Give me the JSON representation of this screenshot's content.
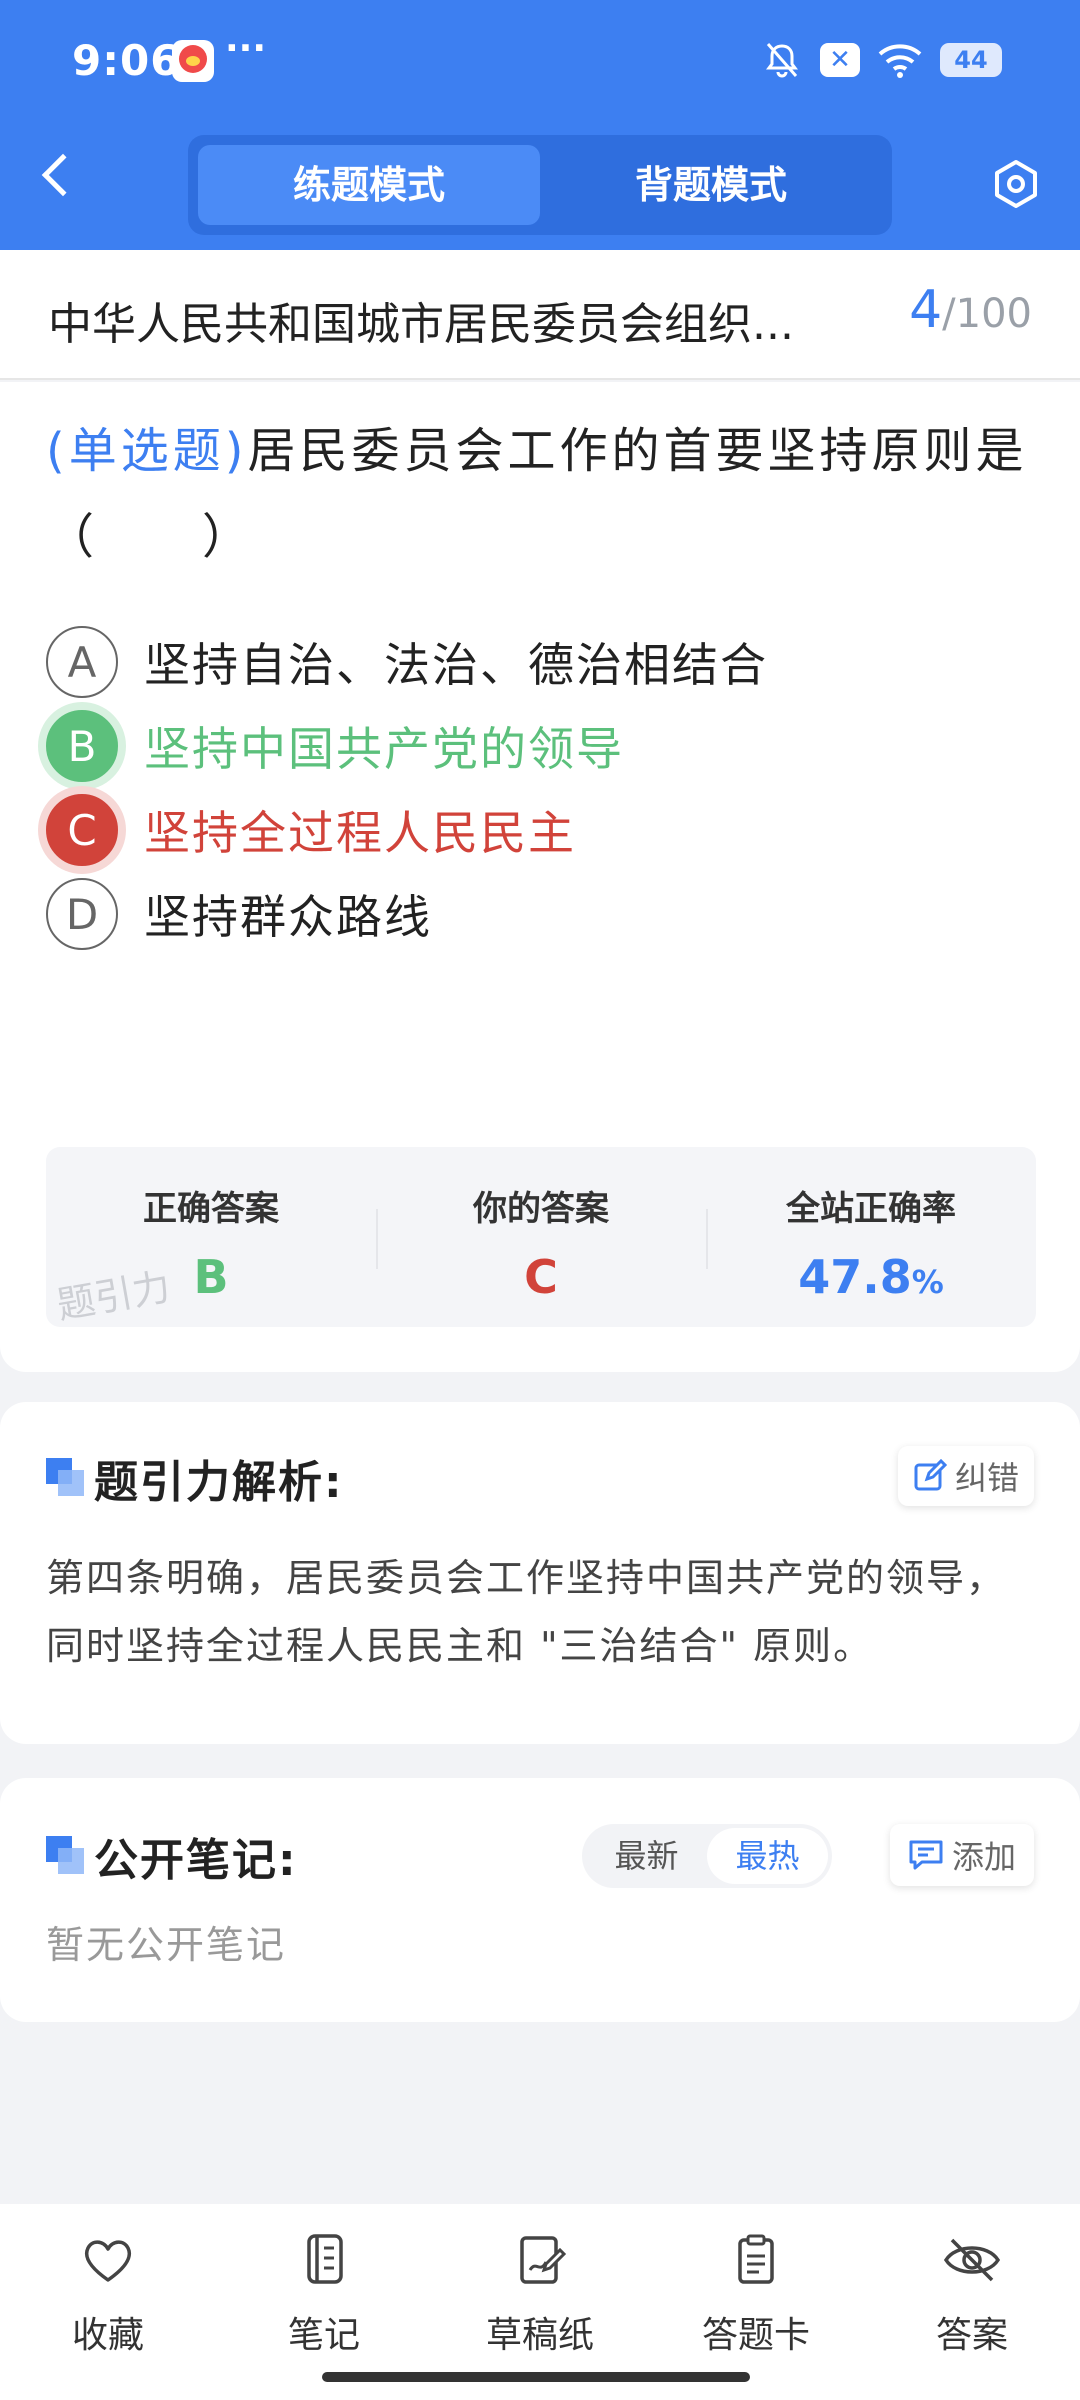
{
  "status_bar": {
    "time": "9:06",
    "more": "···",
    "battery": "44"
  },
  "header": {
    "modes": [
      "练题模式",
      "背题模式"
    ],
    "active_mode": "练题模式"
  },
  "title_bar": {
    "title": "中华人民共和国城市居民委员会组织...",
    "current": "4",
    "total": "/100"
  },
  "question": {
    "type": "(单选题)",
    "text": "居民委员会工作的首要坚持原则是（　　）",
    "options": [
      {
        "letter": "A",
        "text": "坚持自治、法治、德治相结合",
        "state": "normal"
      },
      {
        "letter": "B",
        "text": "坚持中国共产党的领导",
        "state": "correct"
      },
      {
        "letter": "C",
        "text": "坚持全过程人民民主",
        "state": "wrong"
      },
      {
        "letter": "D",
        "text": "坚持群众路线",
        "state": "normal"
      }
    ]
  },
  "stats": {
    "correct_label": "正确答案",
    "correct_value": "B",
    "yours_label": "你的答案",
    "yours_value": "C",
    "rate_label": "全站正确率",
    "rate_value": "47.8",
    "rate_unit": "%",
    "watermark": "题引力"
  },
  "analysis": {
    "title": "题引力解析:",
    "fix_label": "纠错",
    "text": "第四条明确，居民委员会工作坚持中国共产党的领导，同时坚持全过程人民民主和 \"三治结合\" 原则。"
  },
  "notes": {
    "title": "公开笔记:",
    "sort_options": [
      "最新",
      "最热"
    ],
    "active_sort": "最热",
    "add_label": "添加",
    "empty_text": "暂无公开笔记"
  },
  "bottom_nav": [
    {
      "label": "收藏",
      "icon": "heart-icon"
    },
    {
      "label": "笔记",
      "icon": "notebook-icon"
    },
    {
      "label": "草稿纸",
      "icon": "draft-icon"
    },
    {
      "label": "答题卡",
      "icon": "answer-sheet-icon"
    },
    {
      "label": "答案",
      "icon": "eye-off-icon"
    }
  ],
  "colors": {
    "primary": "#3d7ff1",
    "correct": "#5cc07c",
    "wrong": "#d1433a"
  }
}
